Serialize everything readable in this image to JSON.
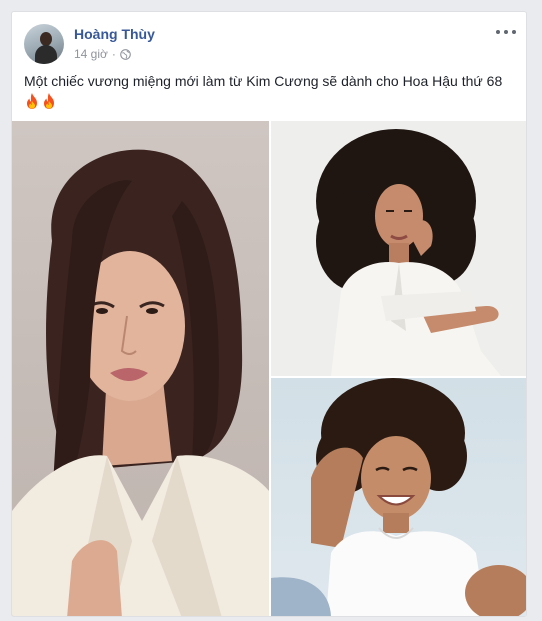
{
  "post": {
    "author": "Hoàng Thùy",
    "time": "14 giờ",
    "separator": "·",
    "privacy_icon": "globe-icon",
    "menu_icon": "more-options-icon",
    "text": "Một chiếc vương miệng mới làm từ Kim Cương sẽ dành cho Hoa Hậu thứ 68",
    "emojis": [
      "fire-icon",
      "fire-icon"
    ]
  },
  "photos": [
    {
      "description_icon": "photo-woman-straight-hair"
    },
    {
      "description_icon": "photo-woman-curly-hair-white-dress"
    },
    {
      "description_icon": "photo-woman-short-curly-hair-smiling"
    }
  ],
  "colors": {
    "author_link": "#385898",
    "meta_text": "#90949c",
    "body_text": "#1d2129",
    "page_bg": "#e9ebee",
    "card_bg": "#ffffff"
  }
}
